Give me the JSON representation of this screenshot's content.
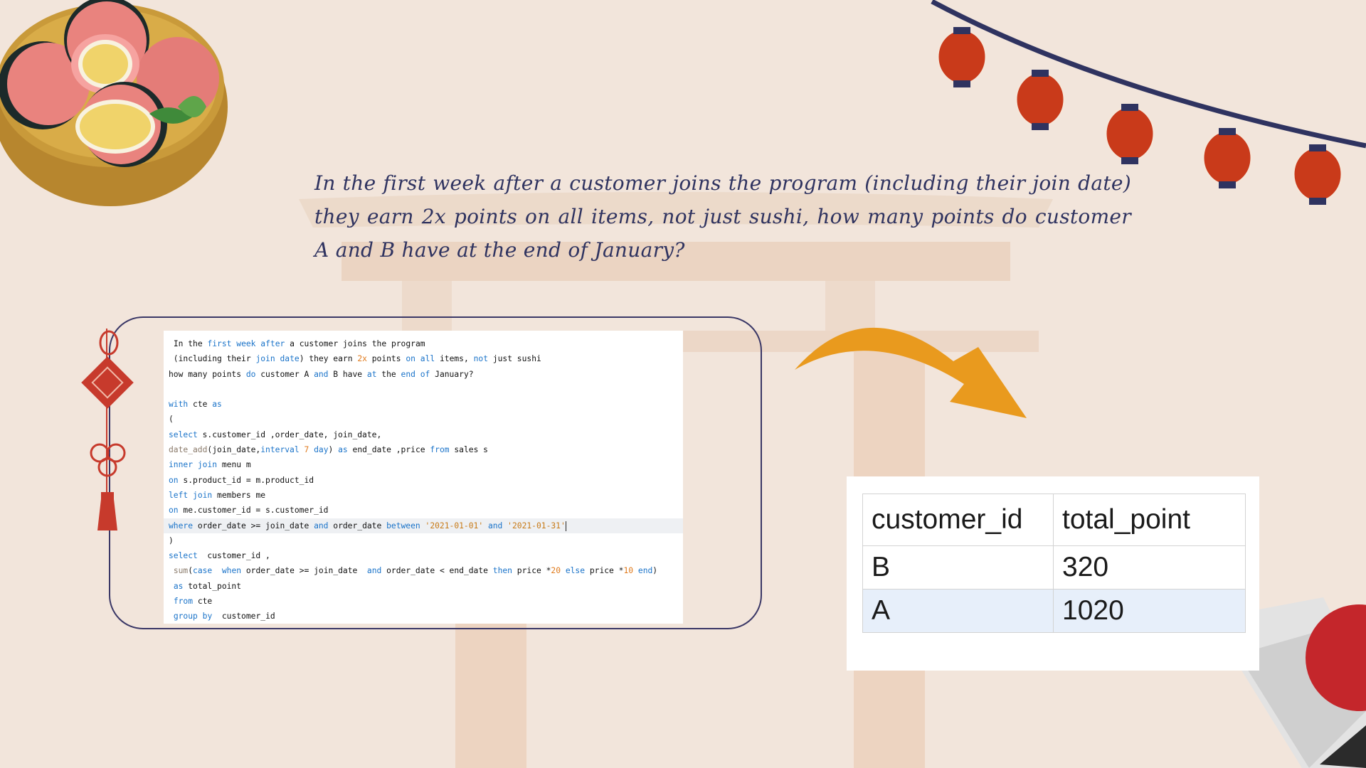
{
  "question": "In the first week after a customer joins the program (including their join date) they earn 2x points on all items, not just sushi, how many points do customer A and B have at the end of January?",
  "code_lines": [
    {
      "hl": false,
      "tokens": [
        {
          "t": " "
        },
        {
          "t": "In",
          "c": "plain"
        },
        {
          "t": " the "
        },
        {
          "t": "first",
          "c": "kw"
        },
        {
          "t": " "
        },
        {
          "t": "week",
          "c": "kw"
        },
        {
          "t": " "
        },
        {
          "t": "after",
          "c": "kw"
        },
        {
          "t": " a customer joins the program"
        }
      ]
    },
    {
      "hl": false,
      "tokens": [
        {
          "t": " (including their "
        },
        {
          "t": "join",
          "c": "kw"
        },
        {
          "t": " "
        },
        {
          "t": "date",
          "c": "kw"
        },
        {
          "t": ") they earn "
        },
        {
          "t": "2x",
          "c": "num"
        },
        {
          "t": " points "
        },
        {
          "t": "on",
          "c": "kw"
        },
        {
          "t": " "
        },
        {
          "t": "all",
          "c": "kw"
        },
        {
          "t": " items, "
        },
        {
          "t": "not",
          "c": "kw"
        },
        {
          "t": " just sushi"
        }
      ]
    },
    {
      "hl": false,
      "tokens": [
        {
          "t": "how many points "
        },
        {
          "t": "do",
          "c": "kw"
        },
        {
          "t": " customer A "
        },
        {
          "t": "and",
          "c": "kw"
        },
        {
          "t": " B have "
        },
        {
          "t": "at",
          "c": "kw"
        },
        {
          "t": " the "
        },
        {
          "t": "end",
          "c": "kw"
        },
        {
          "t": " "
        },
        {
          "t": "of",
          "c": "kw"
        },
        {
          "t": " January?"
        }
      ]
    },
    {
      "hl": false,
      "tokens": [
        {
          "t": ""
        }
      ]
    },
    {
      "hl": false,
      "tokens": [
        {
          "t": "with",
          "c": "kw"
        },
        {
          "t": " cte "
        },
        {
          "t": "as",
          "c": "kw"
        }
      ]
    },
    {
      "hl": false,
      "tokens": [
        {
          "t": "("
        }
      ]
    },
    {
      "hl": false,
      "tokens": [
        {
          "t": "select",
          "c": "kw"
        },
        {
          "t": " s.customer_id ,order_date, join_date,"
        }
      ]
    },
    {
      "hl": false,
      "tokens": [
        {
          "t": "date_add",
          "c": "fn"
        },
        {
          "t": "(join_date,"
        },
        {
          "t": "interval",
          "c": "kw"
        },
        {
          "t": " "
        },
        {
          "t": "7",
          "c": "num"
        },
        {
          "t": " "
        },
        {
          "t": "day",
          "c": "kw"
        },
        {
          "t": ") "
        },
        {
          "t": "as",
          "c": "kw"
        },
        {
          "t": " end_date ,price "
        },
        {
          "t": "from",
          "c": "kw"
        },
        {
          "t": " sales s"
        }
      ]
    },
    {
      "hl": false,
      "tokens": [
        {
          "t": "inner",
          "c": "kw"
        },
        {
          "t": " "
        },
        {
          "t": "join",
          "c": "kw"
        },
        {
          "t": " menu m"
        }
      ]
    },
    {
      "hl": false,
      "tokens": [
        {
          "t": "on",
          "c": "kw"
        },
        {
          "t": " s.product_id = m.product_id"
        }
      ]
    },
    {
      "hl": false,
      "tokens": [
        {
          "t": "left",
          "c": "kw"
        },
        {
          "t": " "
        },
        {
          "t": "join",
          "c": "kw"
        },
        {
          "t": " members me"
        }
      ]
    },
    {
      "hl": false,
      "tokens": [
        {
          "t": "on",
          "c": "kw"
        },
        {
          "t": " me.customer_id = s.customer_id"
        }
      ]
    },
    {
      "hl": true,
      "tokens": [
        {
          "t": "where",
          "c": "kw"
        },
        {
          "t": " order_date >= join_date "
        },
        {
          "t": "and",
          "c": "kw"
        },
        {
          "t": " order_date "
        },
        {
          "t": "between",
          "c": "kw"
        },
        {
          "t": " "
        },
        {
          "t": "'2021-01-01'",
          "c": "str"
        },
        {
          "t": " "
        },
        {
          "t": "and",
          "c": "kw"
        },
        {
          "t": " "
        },
        {
          "t": "'2021-01-31'",
          "c": "str"
        }
      ]
    },
    {
      "hl": false,
      "tokens": [
        {
          "t": ")"
        }
      ]
    },
    {
      "hl": false,
      "tokens": [
        {
          "t": "select",
          "c": "kw"
        },
        {
          "t": "  customer_id ,"
        }
      ]
    },
    {
      "hl": false,
      "tokens": [
        {
          "t": " "
        },
        {
          "t": "sum",
          "c": "fn"
        },
        {
          "t": "("
        },
        {
          "t": "case",
          "c": "kw"
        },
        {
          "t": "  "
        },
        {
          "t": "when",
          "c": "kw"
        },
        {
          "t": " order_date >= join_date  "
        },
        {
          "t": "and",
          "c": "kw"
        },
        {
          "t": " order_date < end_date "
        },
        {
          "t": "then",
          "c": "kw"
        },
        {
          "t": " price *"
        },
        {
          "t": "20",
          "c": "num"
        },
        {
          "t": " "
        },
        {
          "t": "else",
          "c": "kw"
        },
        {
          "t": " price *"
        },
        {
          "t": "10",
          "c": "num"
        },
        {
          "t": " "
        },
        {
          "t": "end",
          "c": "kw"
        },
        {
          "t": ")"
        }
      ]
    },
    {
      "hl": false,
      "tokens": [
        {
          "t": " "
        },
        {
          "t": "as",
          "c": "kw"
        },
        {
          "t": " total_point"
        }
      ]
    },
    {
      "hl": false,
      "tokens": [
        {
          "t": " "
        },
        {
          "t": "from",
          "c": "kw"
        },
        {
          "t": " cte"
        }
      ]
    },
    {
      "hl": false,
      "tokens": [
        {
          "t": " "
        },
        {
          "t": "group",
          "c": "kw"
        },
        {
          "t": " "
        },
        {
          "t": "by",
          "c": "kw"
        },
        {
          "t": "  customer_id"
        }
      ]
    }
  ],
  "result": {
    "columns": [
      "customer_id",
      "total_point"
    ],
    "rows": [
      {
        "customer_id": "B",
        "total_point": "320"
      },
      {
        "customer_id": "A",
        "total_point": "1020"
      }
    ]
  },
  "colors": {
    "background": "#f2e5db",
    "navy": "#2f3360",
    "keyword": "#1a73c9",
    "literal": "#e07a1c",
    "arrow": "#e99a1e",
    "lantern": "#c93a1a"
  },
  "icons": [
    "mochi-bowl-icon",
    "lantern-string-icon",
    "chinese-knot-icon",
    "curved-arrow-icon",
    "paper-fan-icon",
    "torii-gate-icon"
  ]
}
